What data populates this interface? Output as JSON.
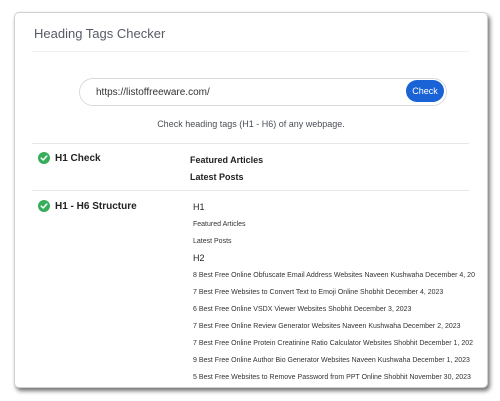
{
  "title": "Heading Tags Checker",
  "search": {
    "value": "https://listoffreeware.com/",
    "button_label": "Check"
  },
  "subtitle": "Check heading tags (H1 - H6) of any webpage.",
  "h1_check": {
    "label": "H1 Check",
    "items": [
      "Featured Articles",
      "Latest Posts"
    ]
  },
  "structure": {
    "label": "H1 - H6 Structure",
    "h1_heading": "H1",
    "h1_items": [
      "Featured Articles",
      "Latest Posts"
    ],
    "h2_heading": "H2",
    "h2_items": [
      "8 Best Free Online Obfuscate Email Address Websites Naveen Kushwaha December 4, 20",
      "7 Best Free Websites to Convert Text to Emoji Online Shobhit December 4, 2023",
      "6 Best Free Online VSDX Viewer Websites Shobhit December 3, 2023",
      "7 Best Free Online Review Generator Websites Naveen Kushwaha December 2, 2023",
      "7 Best Free Online Protein Creatinine Ratio Calculator Websites Shobhit December 1, 202",
      "9 Best Free Online Author Bio Generator Websites Naveen Kushwaha December 1, 2023",
      "5 Best Free Websites to Remove Password from PPT Online Shobhit November 30, 2023"
    ]
  },
  "colors": {
    "accent": "#1a63d6",
    "success": "#36ad5a"
  },
  "icons": {
    "status": "check-circle-icon"
  }
}
